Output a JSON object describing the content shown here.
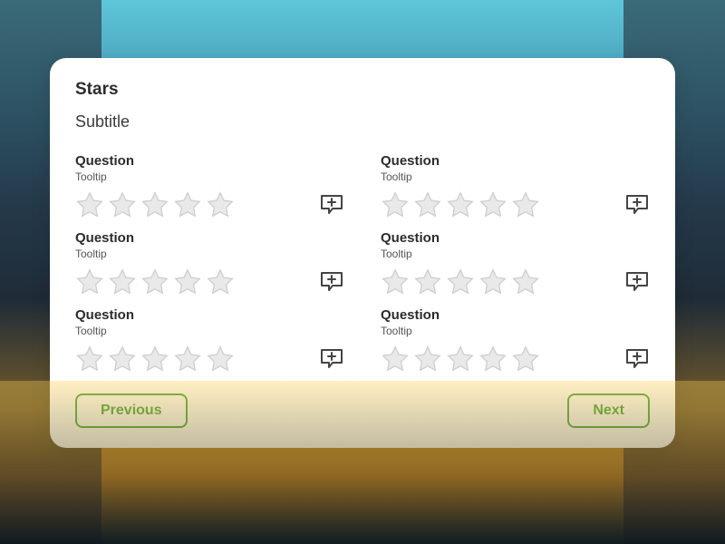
{
  "header": {
    "title": "Stars",
    "subtitle": "Subtitle"
  },
  "columns": [
    {
      "items": [
        {
          "question": "Question",
          "tooltip": "Tooltip"
        },
        {
          "question": "Question",
          "tooltip": "Tooltip"
        },
        {
          "question": "Question",
          "tooltip": "Tooltip"
        }
      ]
    },
    {
      "items": [
        {
          "question": "Question",
          "tooltip": "Tooltip"
        },
        {
          "question": "Question",
          "tooltip": "Tooltip"
        },
        {
          "question": "Question",
          "tooltip": "Tooltip"
        }
      ]
    }
  ],
  "nav": {
    "previous_label": "Previous",
    "next_label": "Next"
  },
  "theme": {
    "accent": "#44a736",
    "star_fill": "#e9e9e9",
    "star_stroke": "#cfcfcf",
    "icon_stroke": "#444444"
  },
  "stars_per_question": 5
}
